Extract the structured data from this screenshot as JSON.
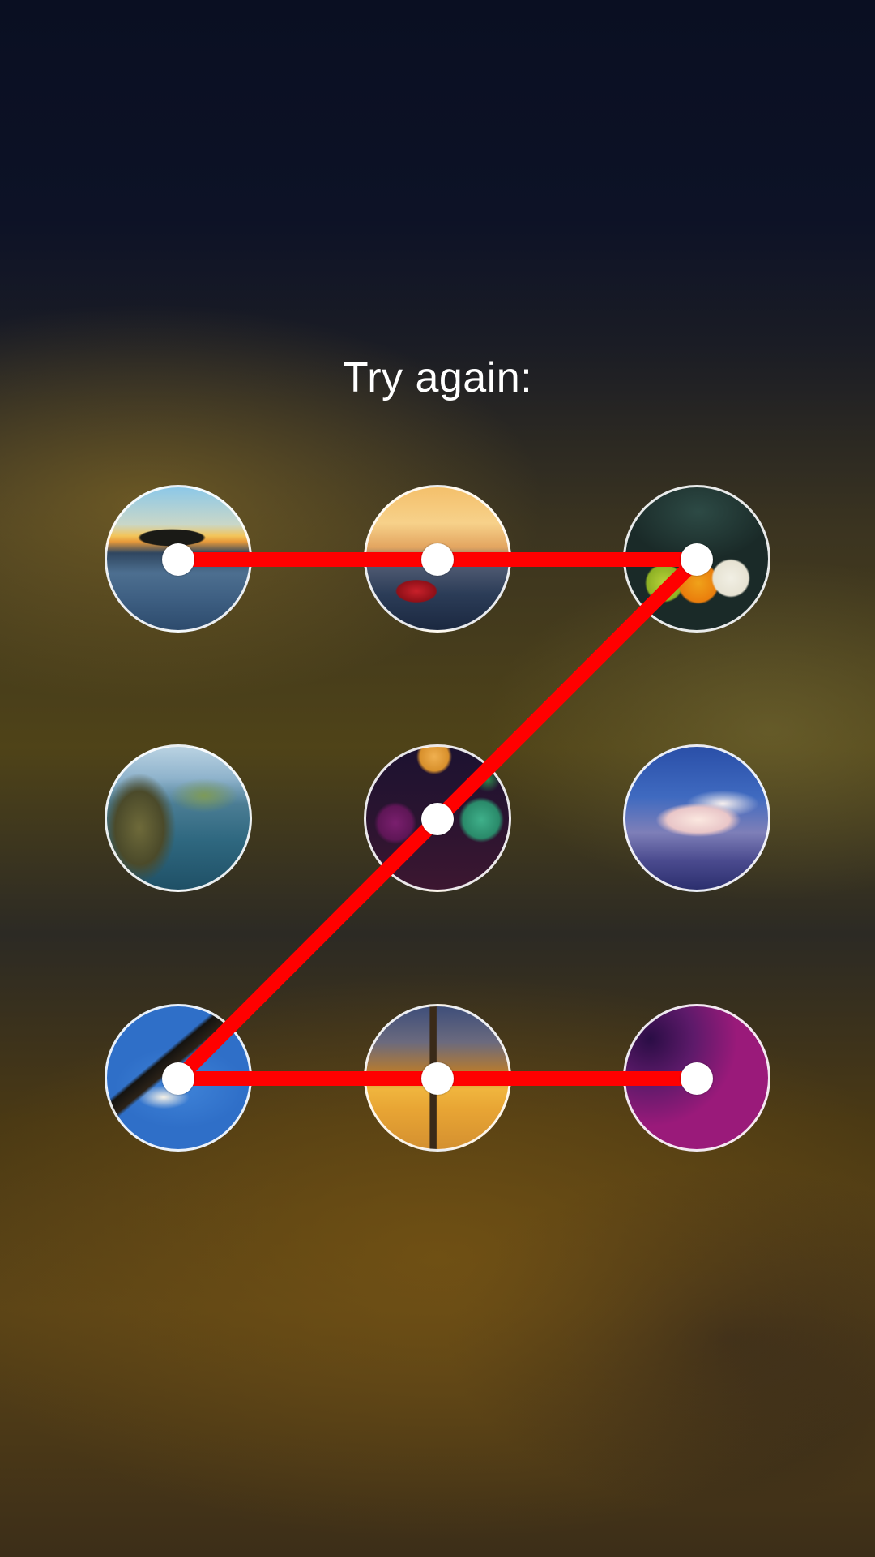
{
  "prompt": {
    "text": "Try again:"
  },
  "pattern": {
    "line_color": "#ff0000",
    "dot_color": "#ffffff",
    "path": [
      1,
      2,
      3,
      5,
      7,
      8,
      9
    ],
    "nodes": [
      {
        "index": 1,
        "image": "sunset-island-thumbnail"
      },
      {
        "index": 2,
        "image": "boat-on-lake-thumbnail"
      },
      {
        "index": 3,
        "image": "funny-eggs-thumbnail"
      },
      {
        "index": 4,
        "image": "sea-cliff-thumbnail"
      },
      {
        "index": 5,
        "image": "bokeh-lights-thumbnail"
      },
      {
        "index": 6,
        "image": "sky-clouds-thumbnail"
      },
      {
        "index": 7,
        "image": "bald-eagle-thumbnail"
      },
      {
        "index": 8,
        "image": "london-skyline-thumbnail"
      },
      {
        "index": 9,
        "image": "purple-gradient-thumbnail"
      }
    ]
  }
}
